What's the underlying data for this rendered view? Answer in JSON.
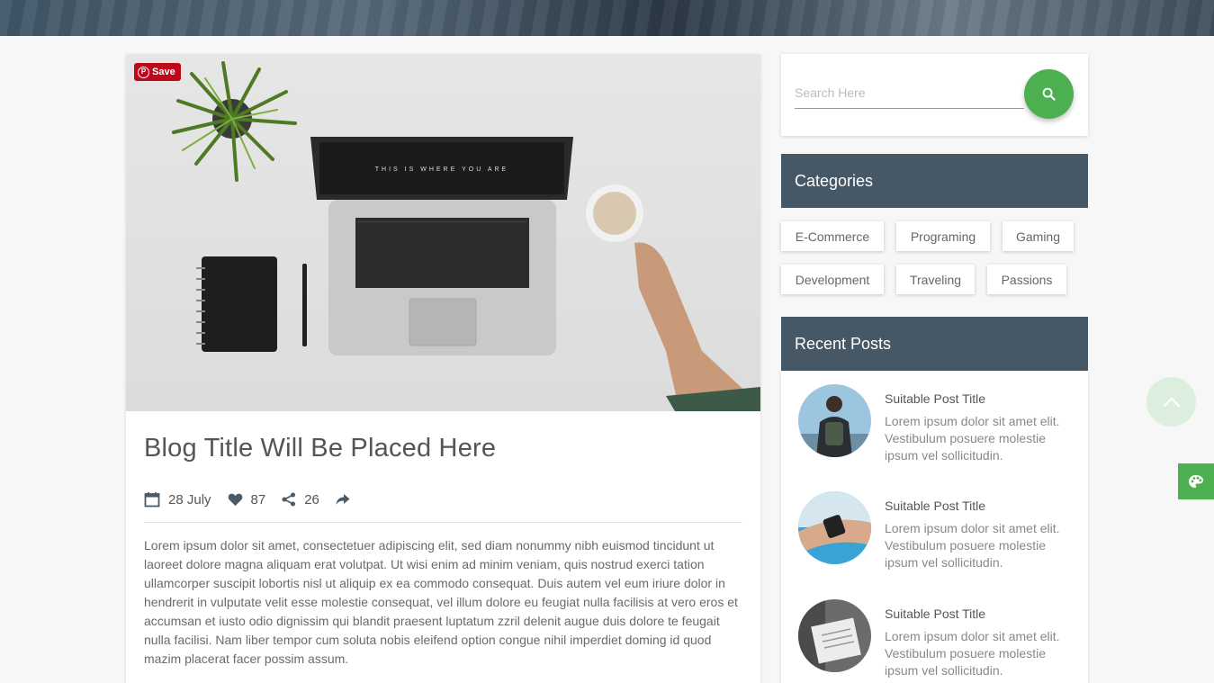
{
  "pinterest": {
    "save_label": "Save"
  },
  "post": {
    "title": "Blog Title Will Be Placed Here",
    "date": "28 July",
    "likes": "87",
    "shares": "26",
    "body": "Lorem ipsum dolor sit amet, consectetuer adipiscing elit, sed diam nonummy nibh euismod tincidunt ut laoreet dolore magna aliquam erat volutpat. Ut wisi enim ad minim veniam, quis nostrud exerci tation ullamcorper suscipit lobortis nisl ut aliquip ex ea commodo consequat. Duis autem vel eum iriure dolor in hendrerit in vulputate velit esse molestie consequat, vel illum dolore eu feugiat nulla facilisis at vero eros et accumsan et iusto odio dignissim qui blandit praesent luptatum zzril delenit augue duis dolore te feugait nulla facilisi. Nam liber tempor cum soluta nobis eleifend option congue nihil imperdiet doming id quod mazim placerat facer possim assum."
  },
  "search": {
    "placeholder": "Search Here"
  },
  "categories": {
    "title": "Categories",
    "items": [
      "E-Commerce",
      "Programing",
      "Gaming",
      "Development",
      "Traveling",
      "Passions"
    ]
  },
  "recent": {
    "title": "Recent Posts",
    "items": [
      {
        "title": "Suitable Post Title",
        "excerpt": "Lorem ipsum dolor sit amet elit. Vestibulum posuere molestie ipsum vel sollicitudin."
      },
      {
        "title": "Suitable Post Title",
        "excerpt": "Lorem ipsum dolor sit amet elit. Vestibulum posuere molestie ipsum vel sollicitudin."
      },
      {
        "title": "Suitable Post Title",
        "excerpt": "Lorem ipsum dolor sit amet elit. Vestibulum posuere molestie ipsum vel sollicitudin."
      }
    ]
  },
  "icons": {
    "calendar": "calendar-icon",
    "heart": "heart-icon",
    "share": "share-icon",
    "forward": "forward-icon",
    "search": "search-icon",
    "arrow_up": "chevron-up-icon",
    "palette": "palette-icon"
  },
  "colors": {
    "accent": "#4caf50",
    "widget_header": "#465865",
    "pinterest": "#bd081c"
  }
}
